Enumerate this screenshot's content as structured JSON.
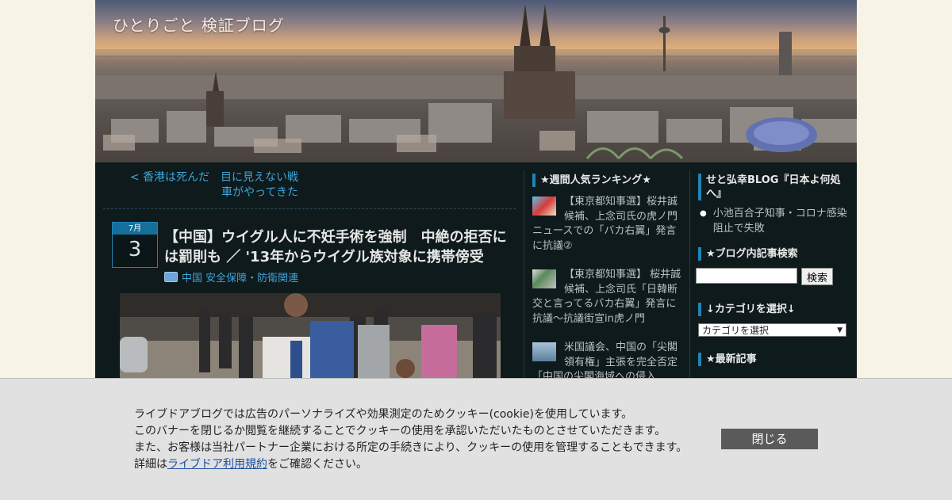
{
  "blog": {
    "title": "ひとりごと 検証ブログ"
  },
  "post": {
    "prev_link": "< 香港は死んだ　目に見えない戦車がやってきた",
    "date_month": "7月",
    "date_day": "3",
    "title": "【中国】ウイグル人に不妊手術を強制　中絶の拒否には罰則も ／ '13年からウイグル族対象に携帯傍受",
    "category": "中国 安全保障・防衛関連"
  },
  "ranking": {
    "title": "★週間人気ランキング★",
    "items": [
      {
        "text": "【東京都知事選】桜井誠候補、上念司氏の虎ノ門ニュースでの「バカ右翼」発言に抗議②"
      },
      {
        "text": "【東京都知事選】 桜井誠候補、上念司氏「日韓断交と言ってるバカ右翼」発言に抗議～抗議街宣in虎ノ門"
      },
      {
        "text": "米国議会、中国の「尖閣領有権」主張を完全否定　「中国の尖閣海域への侵入"
      }
    ]
  },
  "sidebar": {
    "blog_title": "せと弘幸BLOG『日本よ何処へ』",
    "blog_link": "小池百合子知事・コロナ感染阻止で失敗",
    "search_title": "★ブログ内記事検索",
    "search_button": "検索",
    "category_title": "↓カテゴリを選択↓",
    "category_select": "カテゴリを選択",
    "recent_title": "★最新記事"
  },
  "cookie": {
    "line1": "ライブドアブログでは広告のパーソナライズや効果測定のためクッキー(cookie)を使用しています。",
    "line2": "このバナーを閉じるか閲覧を継続することでクッキーの使用を承認いただいたものとさせていただきます。",
    "line3": "また、お客様は当社パートナー企業における所定の手続きにより、クッキーの使用を管理することもできます。",
    "line4_prefix": "詳細は",
    "line4_link": "ライブドア利用規約",
    "line4_suffix": "をご確認ください。",
    "close": "閉じる"
  }
}
